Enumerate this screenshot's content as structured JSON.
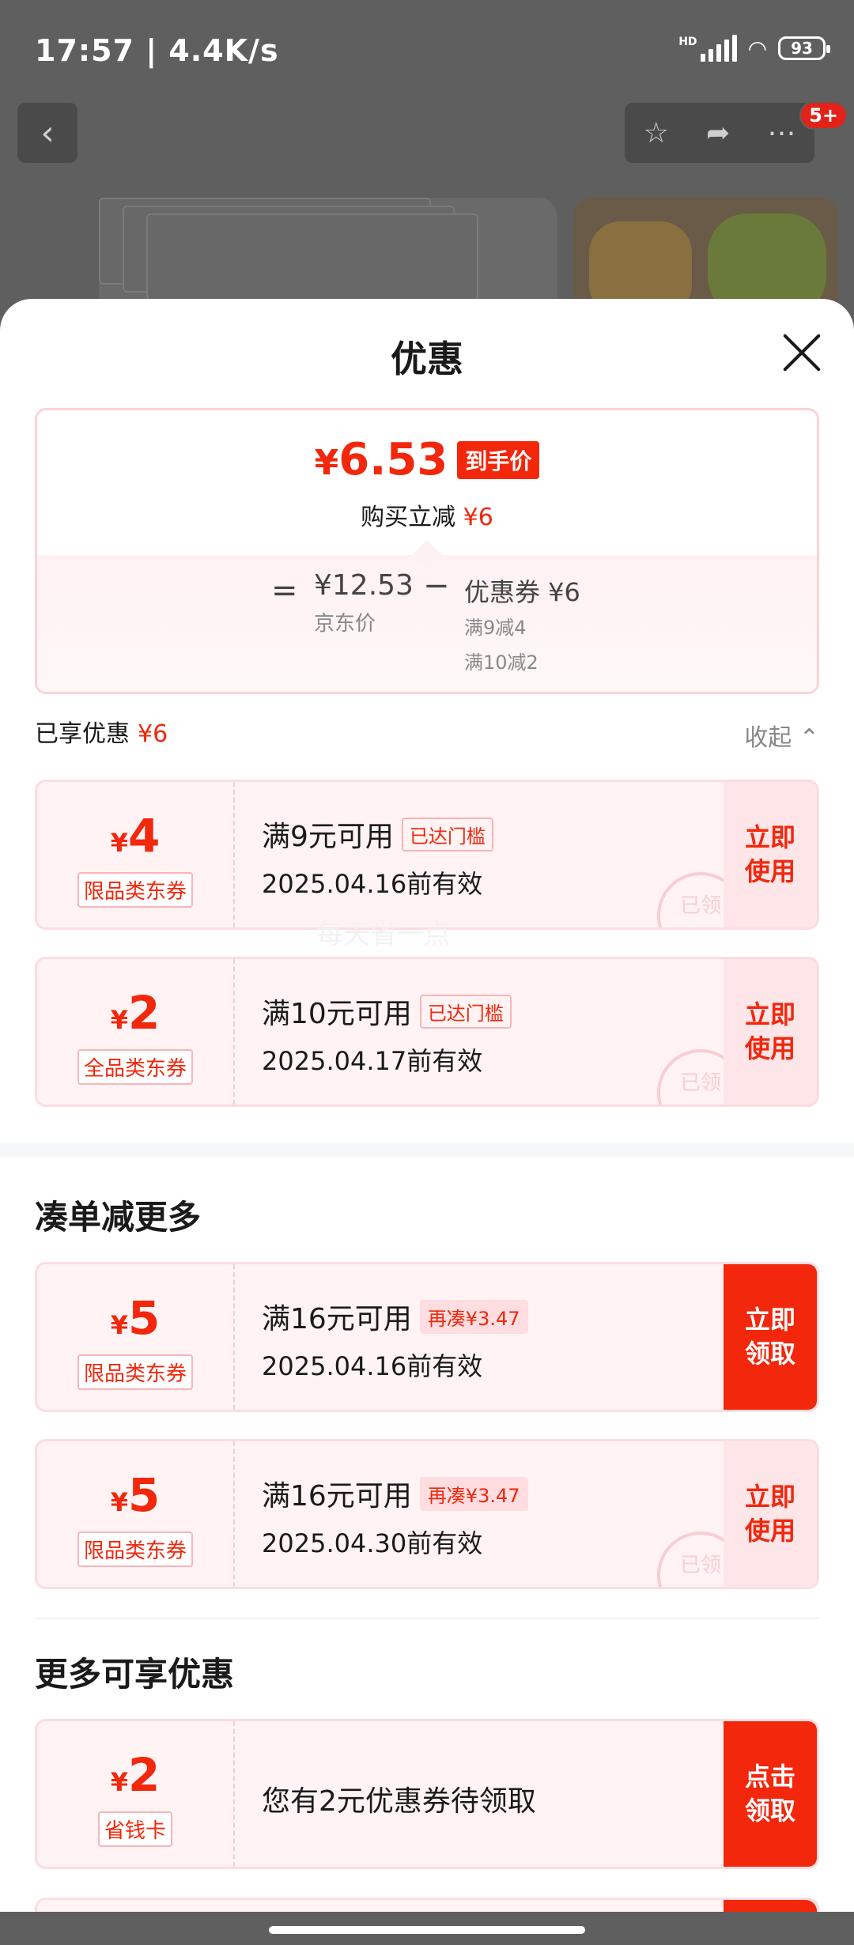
{
  "status": {
    "time": "17:57 | 4.4K/s",
    "network": "HD",
    "battery": "93"
  },
  "header_badge": "5+",
  "sheet": {
    "title": "优惠",
    "final_price_yen": "¥",
    "final_price": "6.53",
    "final_price_tag": "到手价",
    "instant_reduce_label": "购买立减",
    "instant_reduce_value": "¥6",
    "equals": "=",
    "jd_price": "¥12.53",
    "jd_price_label": "京东价",
    "minus": "−",
    "coupon_total": "优惠券 ¥6",
    "coupon_detail_1": "满9减4",
    "coupon_detail_2": "满10减2"
  },
  "enjoyed": {
    "label": "已享优惠",
    "value": "¥6",
    "collapse": "收起"
  },
  "watermark": "每天省一点",
  "applied_coupons": [
    {
      "yen": "¥",
      "amount": "4",
      "type": "限品类东券",
      "cond": "满9元可用",
      "tag": "已达门槛",
      "date": "2025.04.16前有效",
      "action": "立即使用",
      "stamp": "已领"
    },
    {
      "yen": "¥",
      "amount": "2",
      "type": "全品类东券",
      "cond": "满10元可用",
      "tag": "已达门槛",
      "date": "2025.04.17前有效",
      "action": "立即使用",
      "stamp": "已领"
    }
  ],
  "more_section": {
    "title": "凑单减更多"
  },
  "more_coupons": [
    {
      "yen": "¥",
      "amount": "5",
      "type": "限品类东券",
      "cond": "满16元可用",
      "tag": "再凑¥3.47",
      "date": "2025.04.16前有效",
      "action": "立即领取"
    },
    {
      "yen": "¥",
      "amount": "5",
      "type": "限品类东券",
      "cond": "满16元可用",
      "tag": "再凑¥3.47",
      "date": "2025.04.30前有效",
      "action": "立即使用",
      "stamp": "已领"
    }
  ],
  "extra_section": {
    "title": "更多可享优惠"
  },
  "extra_coupons": [
    {
      "yen": "¥",
      "amount": "2",
      "type": "省钱卡",
      "desc": "您有2元优惠券待领取",
      "action": "点击领取"
    }
  ],
  "colors": {
    "accent": "#f2270c",
    "coupon_bg": "#fff3f4",
    "overlay": "#5f5f5f"
  }
}
